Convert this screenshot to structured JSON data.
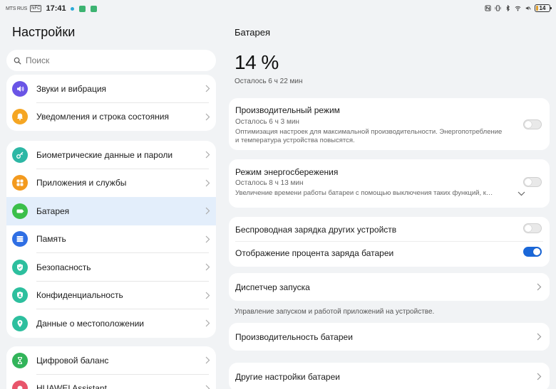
{
  "status": {
    "carrier": "MTS RUS",
    "nfc": "NFC",
    "time": "17:41",
    "battery": "14",
    "battery_fraction": 0.14
  },
  "left": {
    "title": "Настройки",
    "search_placeholder": "Поиск",
    "groups": [
      [
        {
          "label": "Звуки и вибрация",
          "icon": "sound-icon",
          "color": "#6a55e6"
        },
        {
          "label": "Уведомления и строка состояния",
          "icon": "bell-icon",
          "color": "#f5a623"
        }
      ],
      [
        {
          "label": "Биометрические данные и пароли",
          "icon": "key-icon",
          "color": "#2db7a5"
        },
        {
          "label": "Приложения и службы",
          "icon": "apps-icon",
          "color": "#f39a1e"
        },
        {
          "label": "Батарея",
          "icon": "battery-icon",
          "color": "#3bbf4a",
          "active": true
        },
        {
          "label": "Память",
          "icon": "storage-icon",
          "color": "#2f6fe4"
        },
        {
          "label": "Безопасность",
          "icon": "shield-icon",
          "color": "#2dbf9e"
        },
        {
          "label": "Конфиденциальность",
          "icon": "privacy-icon",
          "color": "#2dbf9e"
        },
        {
          "label": "Данные о местоположении",
          "icon": "location-icon",
          "color": "#2dbf9e"
        }
      ],
      [
        {
          "label": "Цифровой баланс",
          "icon": "hourglass-icon",
          "color": "#32b45a"
        },
        {
          "label": "HUAWEI Assistant",
          "icon": "assistant-icon",
          "color": "#e8556b"
        }
      ]
    ]
  },
  "right": {
    "title": "Батарея",
    "percent": "14 %",
    "remaining": "Осталось 6 ч 22 мин",
    "performance": {
      "title": "Производительный режим",
      "sub": "Осталось 6 ч 3 мин",
      "desc": "Оптимизация настроек для максимальной производительности. Энергопотребление и температура устройства повысятся.",
      "on": false
    },
    "powersave": {
      "title": "Режим энергосбережения",
      "sub": "Осталось 8 ч 13 мин",
      "desc": "Увеличение времени работы батареи с помощью выключения таких функций, к…",
      "on": false
    },
    "wireless": {
      "label": "Беспроводная зарядка других устройств",
      "on": false
    },
    "show_percent": {
      "label": "Отображение процента заряда батареи",
      "on": true
    },
    "launch_manager": "Диспетчер запуска",
    "launch_note": "Управление запуском и работой приложений на устройстве.",
    "battery_performance": "Производительность батареи",
    "other_settings": "Другие настройки батареи"
  }
}
